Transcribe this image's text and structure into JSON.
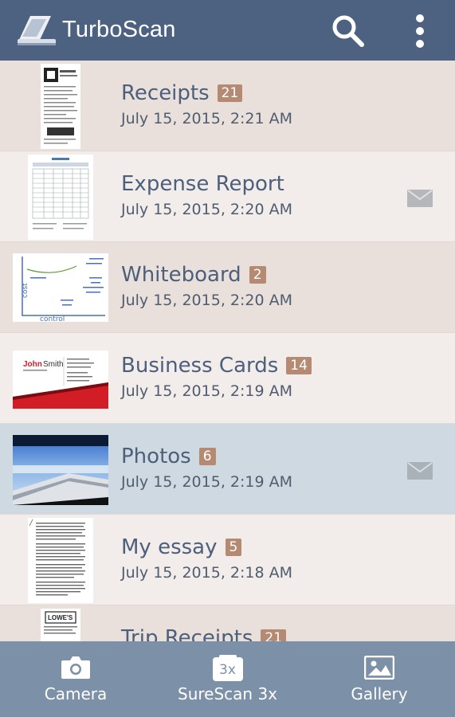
{
  "app": {
    "title": "TurboScan"
  },
  "colors": {
    "appbar": "#4d6280",
    "bottombar": "#7c90a8",
    "badge": "#b58a72",
    "title_text": "#4c5f7b",
    "selected_row": "#cfd9e2"
  },
  "header": {
    "search_icon": "search-icon",
    "menu_icon": "more-vert-icon"
  },
  "documents": [
    {
      "title": "Receipts",
      "count": "21",
      "date": "July 15, 2015, 2:21 AM"
    },
    {
      "title": "Expense Report",
      "count": "",
      "date": "July 15, 2015, 2:20 AM",
      "mail": true
    },
    {
      "title": "Whiteboard",
      "count": "2",
      "date": "July 15, 2015, 2:20 AM"
    },
    {
      "title": "Business Cards",
      "count": "14",
      "date": "July 15, 2015, 2:19 AM"
    },
    {
      "title": "Photos",
      "count": "6",
      "date": "July 15, 2015, 2:19 AM",
      "mail": true,
      "selected": true
    },
    {
      "title": "My essay",
      "count": "5",
      "date": "July 15, 2015, 2:18 AM"
    },
    {
      "title": "Trip Receipts",
      "count": "21",
      "date": ""
    }
  ],
  "thumbnail_text": {
    "whiteboard_axis_y": "cost",
    "whiteboard_axis_x": "control",
    "business_card_first": "John",
    "business_card_last": "Smith",
    "trip_receipt_logo": "LOWE'S"
  },
  "bottom_nav": {
    "camera": "Camera",
    "surescan": "SureScan 3x",
    "surescan_icon_text": "3x",
    "gallery": "Gallery"
  }
}
